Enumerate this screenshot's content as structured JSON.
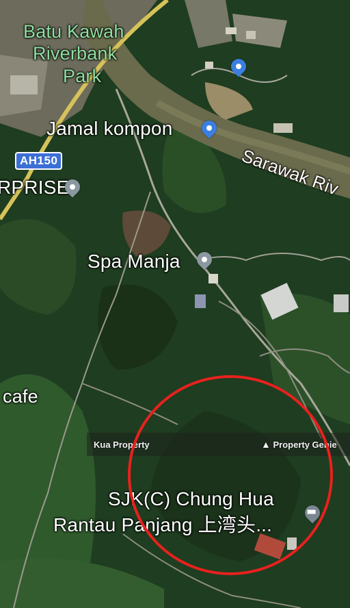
{
  "map": {
    "type": "satellite",
    "places": {
      "park": [
        "Batu Kawah",
        "Riverbank",
        "Park"
      ],
      "jamal": "Jamal kompon",
      "river": "Sarawak Riv",
      "enterprise": "RPRISE",
      "spa": "Spa Manja",
      "cafe": "cafe",
      "school_line1": "SJK(C) Chung Hua",
      "school_line2": "Rantau Panjang 上湾头..."
    },
    "road_shield": "AH150",
    "watermark": {
      "left": "Kua Property",
      "right": "Property Genie",
      "right_icon": "house-icon"
    },
    "highlight_color": "#e8211e",
    "pin_icons": [
      "shopping-pin-icon",
      "shopping-pin-icon",
      "place-pin-icon",
      "place-pin-icon",
      "school-pin-icon"
    ]
  }
}
